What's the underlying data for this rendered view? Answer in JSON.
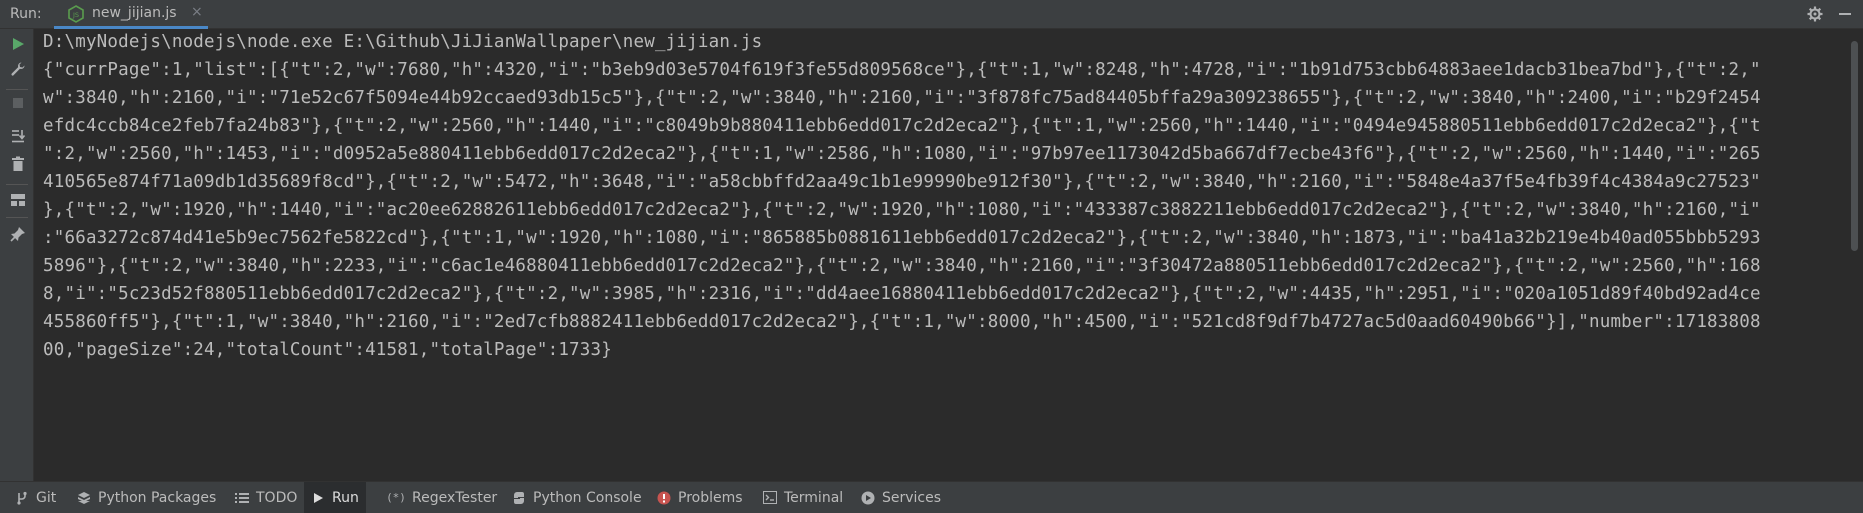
{
  "topbar": {
    "run_label": "Run:",
    "tab_label": "new_jijian.js",
    "tab_close": "×",
    "settings_icon": "gear-icon",
    "minimize_icon": "minimize-icon"
  },
  "left_toolbar": {
    "items": [
      {
        "name": "rerun",
        "icon": "play-icon"
      },
      {
        "name": "modify-config",
        "icon": "wrench-icon"
      },
      {
        "name": "stop",
        "icon": "stop-icon"
      },
      {
        "name": "scroll-to-end",
        "icon": "scroll-end-icon"
      },
      {
        "name": "clear",
        "icon": "trash-icon"
      },
      {
        "name": "layout",
        "icon": "layout-icon"
      },
      {
        "name": "pin",
        "icon": "pin-icon"
      }
    ]
  },
  "console": {
    "lines": [
      "D:\\myNodejs\\nodejs\\node.exe E:\\Github\\JiJianWallpaper\\new_jijian.js",
      "{\"currPage\":1,\"list\":[{\"t\":2,\"w\":7680,\"h\":4320,\"i\":\"b3eb9d03e5704f619f3fe55d809568ce\"},{\"t\":1,\"w\":8248,\"h\":4728,\"i\":\"1b91d753cbb64883aee1dacb31bea7bd\"},{\"t\":2,\"",
      "w\":3840,\"h\":2160,\"i\":\"71e52c67f5094e44b92ccaed93db15c5\"},{\"t\":2,\"w\":3840,\"h\":2160,\"i\":\"3f878fc75ad84405bffa29a309238655\"},{\"t\":2,\"w\":3840,\"h\":2400,\"i\":\"b29f2454",
      "efdc4ccb84ce2feb7fa24b83\"},{\"t\":2,\"w\":2560,\"h\":1440,\"i\":\"c8049b9b880411ebb6edd017c2d2eca2\"},{\"t\":1,\"w\":2560,\"h\":1440,\"i\":\"0494e945880511ebb6edd017c2d2eca2\"},{\"t",
      "\":2,\"w\":2560,\"h\":1453,\"i\":\"d0952a5e880411ebb6edd017c2d2eca2\"},{\"t\":1,\"w\":2586,\"h\":1080,\"i\":\"97b97ee1173042d5ba667df7ecbe43f6\"},{\"t\":2,\"w\":2560,\"h\":1440,\"i\":\"265",
      "410565e874f71a09db1d35689f8cd\"},{\"t\":2,\"w\":5472,\"h\":3648,\"i\":\"a58cbbffd2aa49c1b1e99990be912f30\"},{\"t\":2,\"w\":3840,\"h\":2160,\"i\":\"5848e4a37f5e4fb39f4c4384a9c27523\"",
      "},{\"t\":2,\"w\":1920,\"h\":1440,\"i\":\"ac20ee62882611ebb6edd017c2d2eca2\"},{\"t\":2,\"w\":1920,\"h\":1080,\"i\":\"433387c3882211ebb6edd017c2d2eca2\"},{\"t\":2,\"w\":3840,\"h\":2160,\"i\"",
      ":\"66a3272c874d41e5b9ec7562fe5822cd\"},{\"t\":1,\"w\":1920,\"h\":1080,\"i\":\"865885b0881611ebb6edd017c2d2eca2\"},{\"t\":2,\"w\":3840,\"h\":1873,\"i\":\"ba41a32b219e4b40ad055bbb5293",
      "5896\"},{\"t\":2,\"w\":3840,\"h\":2233,\"i\":\"c6ac1e46880411ebb6edd017c2d2eca2\"},{\"t\":2,\"w\":3840,\"h\":2160,\"i\":\"3f30472a880511ebb6edd017c2d2eca2\"},{\"t\":2,\"w\":2560,\"h\":168",
      "8,\"i\":\"5c23d52f880511ebb6edd017c2d2eca2\"},{\"t\":2,\"w\":3985,\"h\":2316,\"i\":\"dd4aee16880411ebb6edd017c2d2eca2\"},{\"t\":2,\"w\":4435,\"h\":2951,\"i\":\"020a1051d89f40bd92ad4ce",
      "455860ff5\"},{\"t\":1,\"w\":3840,\"h\":2160,\"i\":\"2ed7cfb8882411ebb6edd017c2d2eca2\"},{\"t\":1,\"w\":8000,\"h\":4500,\"i\":\"521cd8f9df7b4727ac5d0aad60490b66\"}],\"number\":17183808",
      "00,\"pageSize\":24,\"totalCount\":41581,\"totalPage\":1733}"
    ]
  },
  "bottombar": {
    "items": [
      {
        "label": "Git",
        "icon": "git-branch-icon"
      },
      {
        "label": "Python Packages",
        "icon": "packages-icon"
      },
      {
        "label": "TODO",
        "icon": "todo-list-icon"
      },
      {
        "label": "Run",
        "icon": "run-play-icon"
      },
      {
        "label": "RegexTester",
        "icon": "regex-icon"
      },
      {
        "label": "Python Console",
        "icon": "python-icon"
      },
      {
        "label": "Problems",
        "icon": "error-icon"
      },
      {
        "label": "Terminal",
        "icon": "terminal-icon"
      },
      {
        "label": "Services",
        "icon": "services-icon"
      }
    ]
  }
}
